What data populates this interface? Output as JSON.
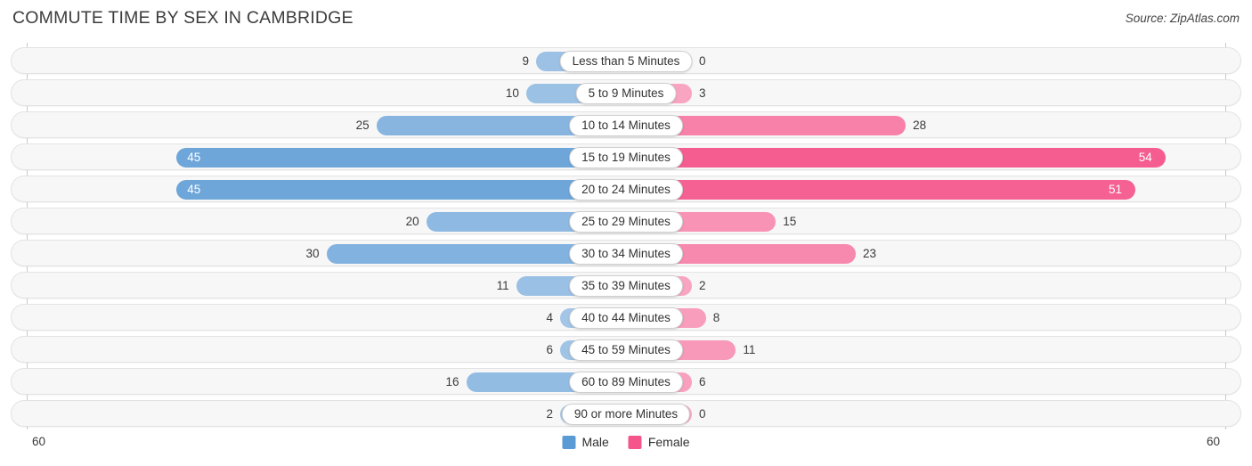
{
  "header": {
    "title": "COMMUTE TIME BY SEX IN CAMBRIDGE",
    "source": "Source: ZipAtlas.com"
  },
  "legend": {
    "items": [
      {
        "label": "Male",
        "color": "#5b9bd5"
      },
      {
        "label": "Female",
        "color": "#f5558a"
      }
    ]
  },
  "axis": {
    "left_tick": "60",
    "right_tick": "60"
  },
  "chart_data": {
    "type": "bar",
    "subtype": "diverging-horizontal-bar",
    "title": "COMMUTE TIME BY SEX IN CAMBRIDGE",
    "source": "Source: ZipAtlas.com",
    "xlabel": "",
    "ylabel": "",
    "xlim": [
      -60,
      60
    ],
    "axis_max": 60,
    "grid": false,
    "legend_position": "bottom-center",
    "categories": [
      "Less than 5 Minutes",
      "5 to 9 Minutes",
      "10 to 14 Minutes",
      "15 to 19 Minutes",
      "20 to 24 Minutes",
      "25 to 29 Minutes",
      "30 to 34 Minutes",
      "35 to 39 Minutes",
      "40 to 44 Minutes",
      "45 to 59 Minutes",
      "60 to 89 Minutes",
      "90 or more Minutes"
    ],
    "series": [
      {
        "name": "Male",
        "direction": "left",
        "color": "#5b9bd5",
        "color_light": "#a8c8e8",
        "values": [
          9,
          10,
          25,
          45,
          45,
          20,
          30,
          11,
          4,
          6,
          16,
          2
        ]
      },
      {
        "name": "Female",
        "direction": "right",
        "color": "#f5558a",
        "color_light": "#f9a8c4",
        "values": [
          0,
          3,
          28,
          54,
          51,
          15,
          23,
          2,
          8,
          11,
          6,
          0
        ]
      }
    ],
    "rows": [
      {
        "category": "Less than 5 Minutes",
        "male": 9,
        "female": 0,
        "male_label": "9",
        "female_label": "0",
        "male_label_inside": false,
        "female_label_inside": false
      },
      {
        "category": "5 to 9 Minutes",
        "male": 10,
        "female": 3,
        "male_label": "10",
        "female_label": "3",
        "male_label_inside": false,
        "female_label_inside": false
      },
      {
        "category": "10 to 14 Minutes",
        "male": 25,
        "female": 28,
        "male_label": "25",
        "female_label": "28",
        "male_label_inside": false,
        "female_label_inside": false
      },
      {
        "category": "15 to 19 Minutes",
        "male": 45,
        "female": 54,
        "male_label": "45",
        "female_label": "54",
        "male_label_inside": true,
        "female_label_inside": true
      },
      {
        "category": "20 to 24 Minutes",
        "male": 45,
        "female": 51,
        "male_label": "45",
        "female_label": "51",
        "male_label_inside": true,
        "female_label_inside": true
      },
      {
        "category": "25 to 29 Minutes",
        "male": 20,
        "female": 15,
        "male_label": "20",
        "female_label": "15",
        "male_label_inside": false,
        "female_label_inside": false
      },
      {
        "category": "30 to 34 Minutes",
        "male": 30,
        "female": 23,
        "male_label": "30",
        "female_label": "23",
        "male_label_inside": false,
        "female_label_inside": false
      },
      {
        "category": "35 to 39 Minutes",
        "male": 11,
        "female": 2,
        "male_label": "11",
        "female_label": "2",
        "male_label_inside": false,
        "female_label_inside": false
      },
      {
        "category": "40 to 44 Minutes",
        "male": 4,
        "female": 8,
        "male_label": "4",
        "female_label": "8",
        "male_label_inside": false,
        "female_label_inside": false
      },
      {
        "category": "45 to 59 Minutes",
        "male": 6,
        "female": 11,
        "male_label": "6",
        "female_label": "11",
        "male_label_inside": false,
        "female_label_inside": false
      },
      {
        "category": "60 to 89 Minutes",
        "male": 16,
        "female": 6,
        "male_label": "16",
        "female_label": "6",
        "male_label_inside": false,
        "female_label_inside": false
      },
      {
        "category": "90 or more Minutes",
        "male": 2,
        "female": 0,
        "male_label": "2",
        "female_label": "0",
        "male_label_inside": false,
        "female_label_inside": false
      }
    ]
  }
}
